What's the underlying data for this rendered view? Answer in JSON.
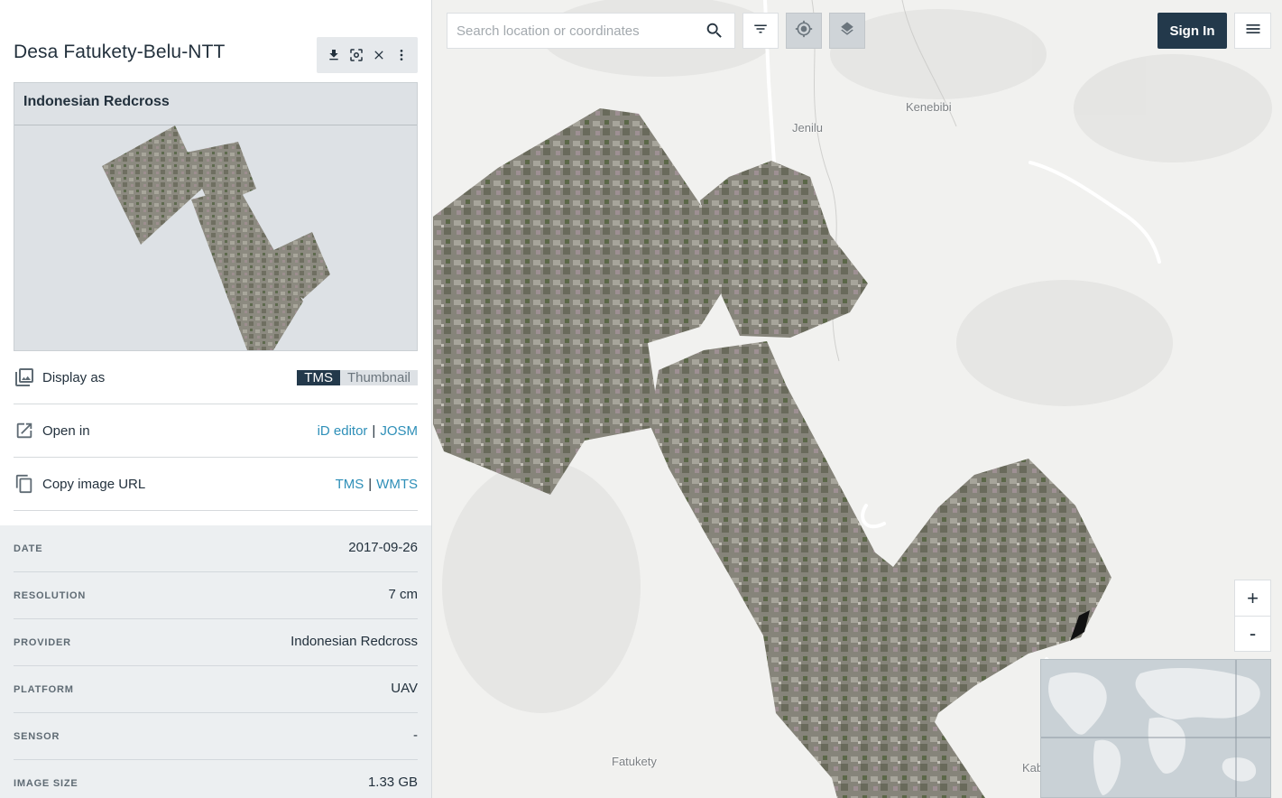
{
  "sidebar": {
    "title": "Desa Fatukety-Belu-NTT",
    "toolbar": {
      "icons": [
        "download-icon",
        "focus-icon",
        "close-icon",
        "more-vertical-icon"
      ]
    },
    "card": {
      "provider_heading": "Indonesian Redcross"
    },
    "display_as": {
      "label": "Display as",
      "options": [
        "TMS",
        "Thumbnail"
      ],
      "selected": "TMS"
    },
    "open_in": {
      "label": "Open in",
      "link1": "iD editor",
      "sep": "|",
      "link2": "JOSM"
    },
    "copy_url": {
      "label": "Copy image URL",
      "link1": "TMS",
      "sep": "|",
      "link2": "WMTS"
    },
    "meta": [
      {
        "key": "DATE",
        "value": "2017-09-26"
      },
      {
        "key": "RESOLUTION",
        "value": "7 cm"
      },
      {
        "key": "PROVIDER",
        "value": "Indonesian Redcross"
      },
      {
        "key": "PLATFORM",
        "value": "UAV"
      },
      {
        "key": "SENSOR",
        "value": "-"
      },
      {
        "key": "IMAGE SIZE",
        "value": "1.33 GB"
      }
    ]
  },
  "map": {
    "search": {
      "placeholder": "Search location or coordinates",
      "value": ""
    },
    "sign_in": "Sign In",
    "zoom_in": "+",
    "zoom_out": "-",
    "places": [
      "Jenilu",
      "Kenebibi",
      "Fatukety",
      "Kab"
    ]
  }
}
